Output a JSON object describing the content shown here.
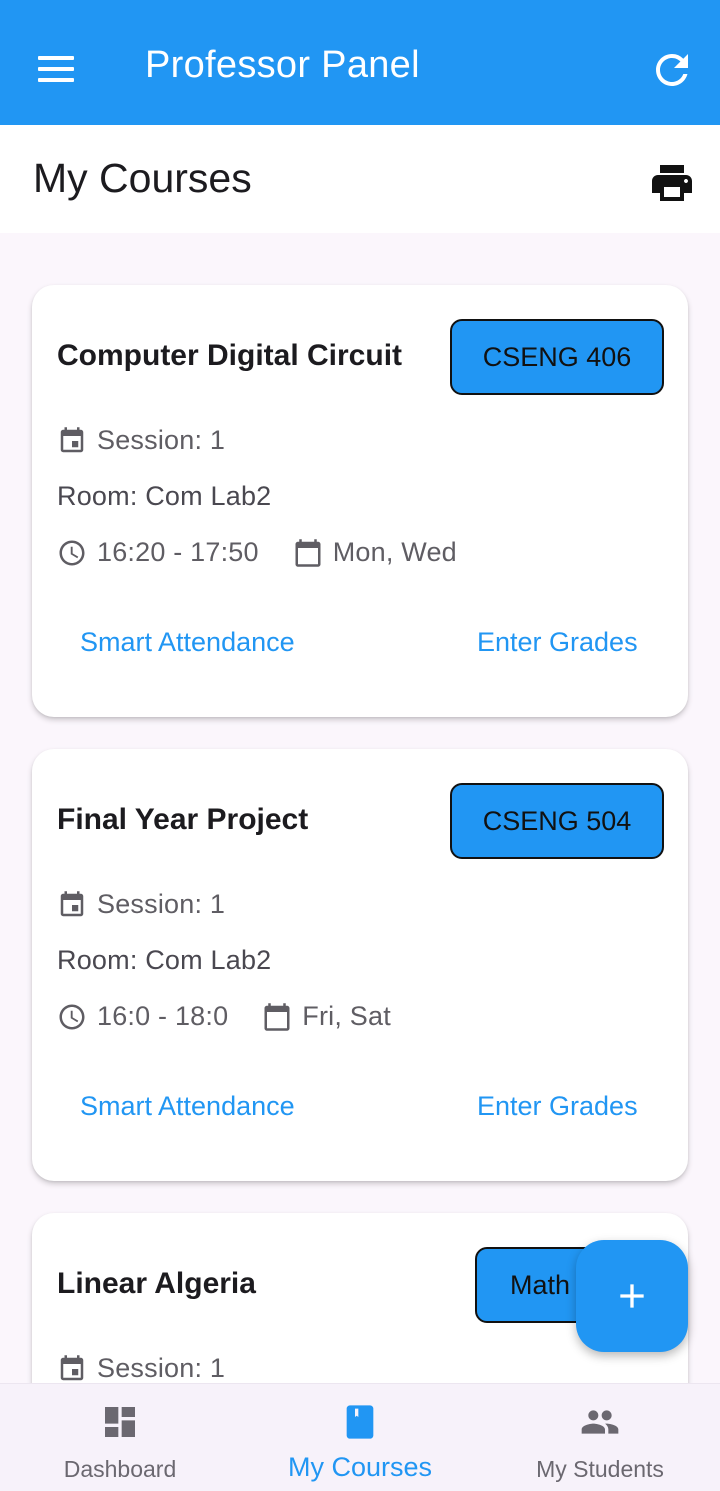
{
  "appbar": {
    "title": "Professor Panel",
    "menu_icon": "menu-icon",
    "refresh_icon": "refresh-icon",
    "color": "#2196f3"
  },
  "page": {
    "heading": "My Courses",
    "print_icon": "print-icon"
  },
  "courses": [
    {
      "title": "Computer Digital Circuit",
      "code": "CSENG 406",
      "session": "Session: 1",
      "room": "Room: Com Lab2",
      "time": "16:20 - 17:50",
      "days": "Mon, Wed",
      "action_attendance": "Smart Attendance",
      "action_grades": "Enter Grades"
    },
    {
      "title": "Final Year Project",
      "code": "CSENG 504",
      "session": "Session: 1",
      "room": "Room: Com Lab2",
      "time": "16:0 - 18:0",
      "days": "Fri, Sat",
      "action_attendance": "Smart Attendance",
      "action_grades": "Enter Grades"
    },
    {
      "title": "Linear Algeria",
      "code": "Math",
      "session": "Session: 1"
    }
  ],
  "fab": {
    "icon": "add-icon"
  },
  "bottom_nav": [
    {
      "label": "Dashboard",
      "icon": "dashboard-icon",
      "active": false
    },
    {
      "label": "My Courses",
      "icon": "book-icon",
      "active": true
    },
    {
      "label": "My Students",
      "icon": "people-icon",
      "active": false
    }
  ],
  "colors": {
    "accent": "#2196f3",
    "background": "#fbf6fc",
    "card": "#ffffff"
  }
}
